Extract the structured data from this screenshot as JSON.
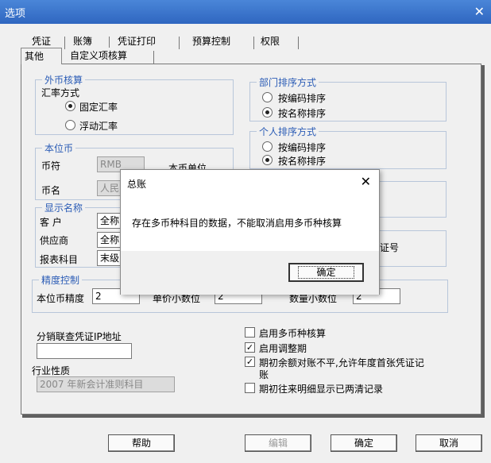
{
  "window": {
    "title": "选项"
  },
  "tabs_row1": [
    "凭证",
    "账簿",
    "凭证打印",
    "预算控制",
    "权限"
  ],
  "tabs_row2": [
    "其他",
    "自定义项核算"
  ],
  "foreign": {
    "legend": "外币核算",
    "rate_mode_label": "汇率方式",
    "fixed_rate": "固定汇率",
    "floating_rate": "浮动汇率"
  },
  "dept_sort": {
    "legend": "部门排序方式",
    "by_code": "按编码排序",
    "by_name": "按名称排序"
  },
  "person_sort": {
    "legend": "个人排序方式",
    "by_code": "按编码排序",
    "by_name": "按名称排序"
  },
  "base_currency": {
    "legend": "本位币",
    "symbol_label": "币符",
    "symbol_value": "RMB",
    "unit_label": "本币单位",
    "name_label": "币名",
    "name_value": "人民"
  },
  "display_name": {
    "legend": "显示名称",
    "customer_label": "客 户",
    "customer_value": "全称",
    "supplier_label": "供应商",
    "supplier_value": "全称",
    "report_label": "报表科目",
    "report_value": "末级"
  },
  "voucher_no_fragment": "证号",
  "precision": {
    "legend": "精度控制",
    "base_label": "本位币精度",
    "base_value": "2",
    "price_label": "单价小数位",
    "price_value": "2",
    "qty_label": "数量小数位",
    "qty_value": "2"
  },
  "ip_label": "分销联查凭证IP地址",
  "ip_value": "",
  "industry_label": "行业性质",
  "industry_value": "2007 年新会计准则科目",
  "options": [
    {
      "label": "启用多币种核算",
      "checked": false
    },
    {
      "label": "启用调整期",
      "checked": true
    },
    {
      "label": "期初余额对账不平,允许年度首张凭证记",
      "label2": "账",
      "checked": true
    },
    {
      "label": "期初往来明细显示已两清记录",
      "checked": false
    }
  ],
  "buttons": {
    "help": "帮助",
    "edit": "编辑",
    "ok": "确定",
    "cancel": "取消"
  },
  "dialog": {
    "title": "总账",
    "message": "存在多币种科目的数据，不能取消启用多币种核算",
    "ok": "确定"
  }
}
